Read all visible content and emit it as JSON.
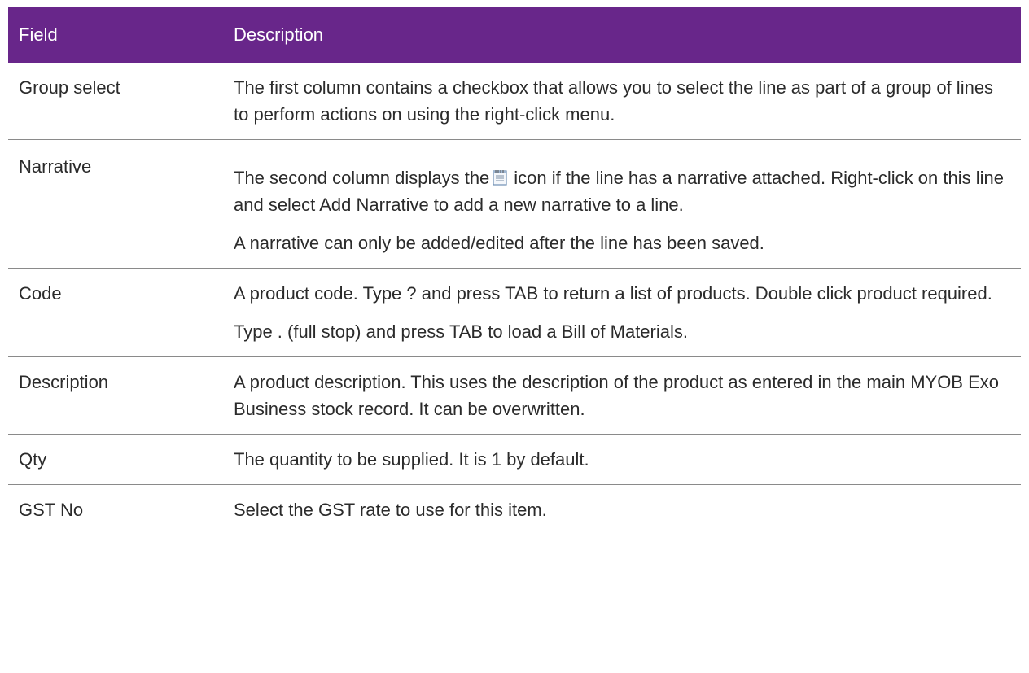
{
  "table": {
    "header": {
      "field": "Field",
      "description": "Description"
    },
    "rows": [
      {
        "field": "Group select",
        "paragraphs": [
          "The first column contains a checkbox that allows you to select the line as part of a group of lines to perform actions on using the right-click menu."
        ]
      },
      {
        "field": "Narrative",
        "text_before_icon": "The second column displays the",
        "icon": "narrative-note-icon",
        "text_after_icon": "icon if the line has a narrative attached. Right-click on this line and select Add Narrative to add a new narrative to a line.",
        "paragraph_2": "A narrative can only be added/edited after the line has been saved."
      },
      {
        "field": "Code",
        "paragraphs": [
          "A product code. Type ? and press TAB to return a list of products. Double click product required.",
          "Type . (full stop) and press TAB to load a Bill of Materials."
        ]
      },
      {
        "field": "Description",
        "paragraphs": [
          "A product description. This uses the description of the product as entered in the main MYOB Exo Business stock record. It can be overwritten."
        ]
      },
      {
        "field": "Qty",
        "paragraphs": [
          "The quantity to be supplied. It is 1 by default."
        ]
      },
      {
        "field": "GST No",
        "paragraphs": [
          "Select the GST rate to use for this item."
        ]
      }
    ]
  },
  "colors": {
    "header_bg": "#68268a",
    "header_text": "#ffffff",
    "body_text": "#2b2b2b",
    "row_divider": "#8a8a8a"
  }
}
